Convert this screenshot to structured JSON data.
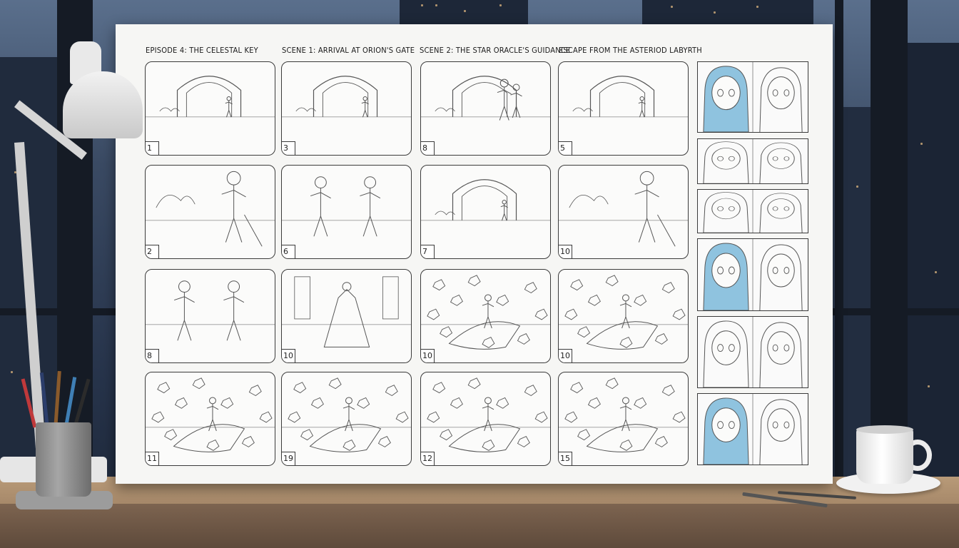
{
  "board": {
    "headings": [
      "EPISODE 4: THE CELESTAL KEY",
      "SCENE 1: ARRIVAL AT ORION'S GATE",
      "SCENE 2: THE STAR ORACLE'S GUIDANCE",
      "ESCAPE FROM THE ASTERIOD LABYRTH"
    ],
    "panels": [
      {
        "number": "1",
        "scene": "arch"
      },
      {
        "number": "3",
        "scene": "arch"
      },
      {
        "number": "8",
        "scene": "figures-arch"
      },
      {
        "number": "5",
        "scene": "arch"
      },
      {
        "number": "2",
        "scene": "hero"
      },
      {
        "number": "6",
        "scene": "two-figures"
      },
      {
        "number": "7",
        "scene": "arch"
      },
      {
        "number": "10",
        "scene": "hero"
      },
      {
        "number": "8",
        "scene": "two-figures"
      },
      {
        "number": "10",
        "scene": "oracle"
      },
      {
        "number": "10",
        "scene": "asteroids"
      },
      {
        "number": "10",
        "scene": "asteroids"
      },
      {
        "number": "11",
        "scene": "asteroids"
      },
      {
        "number": "19",
        "scene": "asteroids"
      },
      {
        "number": "12",
        "scene": "asteroids"
      },
      {
        "number": "15",
        "scene": "asteroids"
      }
    ],
    "character_panels": [
      {
        "hair": "blue"
      },
      {
        "hair": "plain"
      },
      {
        "hair": "plain"
      },
      {
        "hair": "blue"
      },
      {
        "hair": "plain"
      },
      {
        "hair": "blue"
      }
    ]
  },
  "colors": {
    "blue_hair": "#8fc3df",
    "line": "#555555",
    "board": "#f6f6f4"
  },
  "props": {
    "lamp": "desk-lamp-icon",
    "pencil_cup": "pencil-cup-icon",
    "coffee": "coffee-mug-icon"
  }
}
